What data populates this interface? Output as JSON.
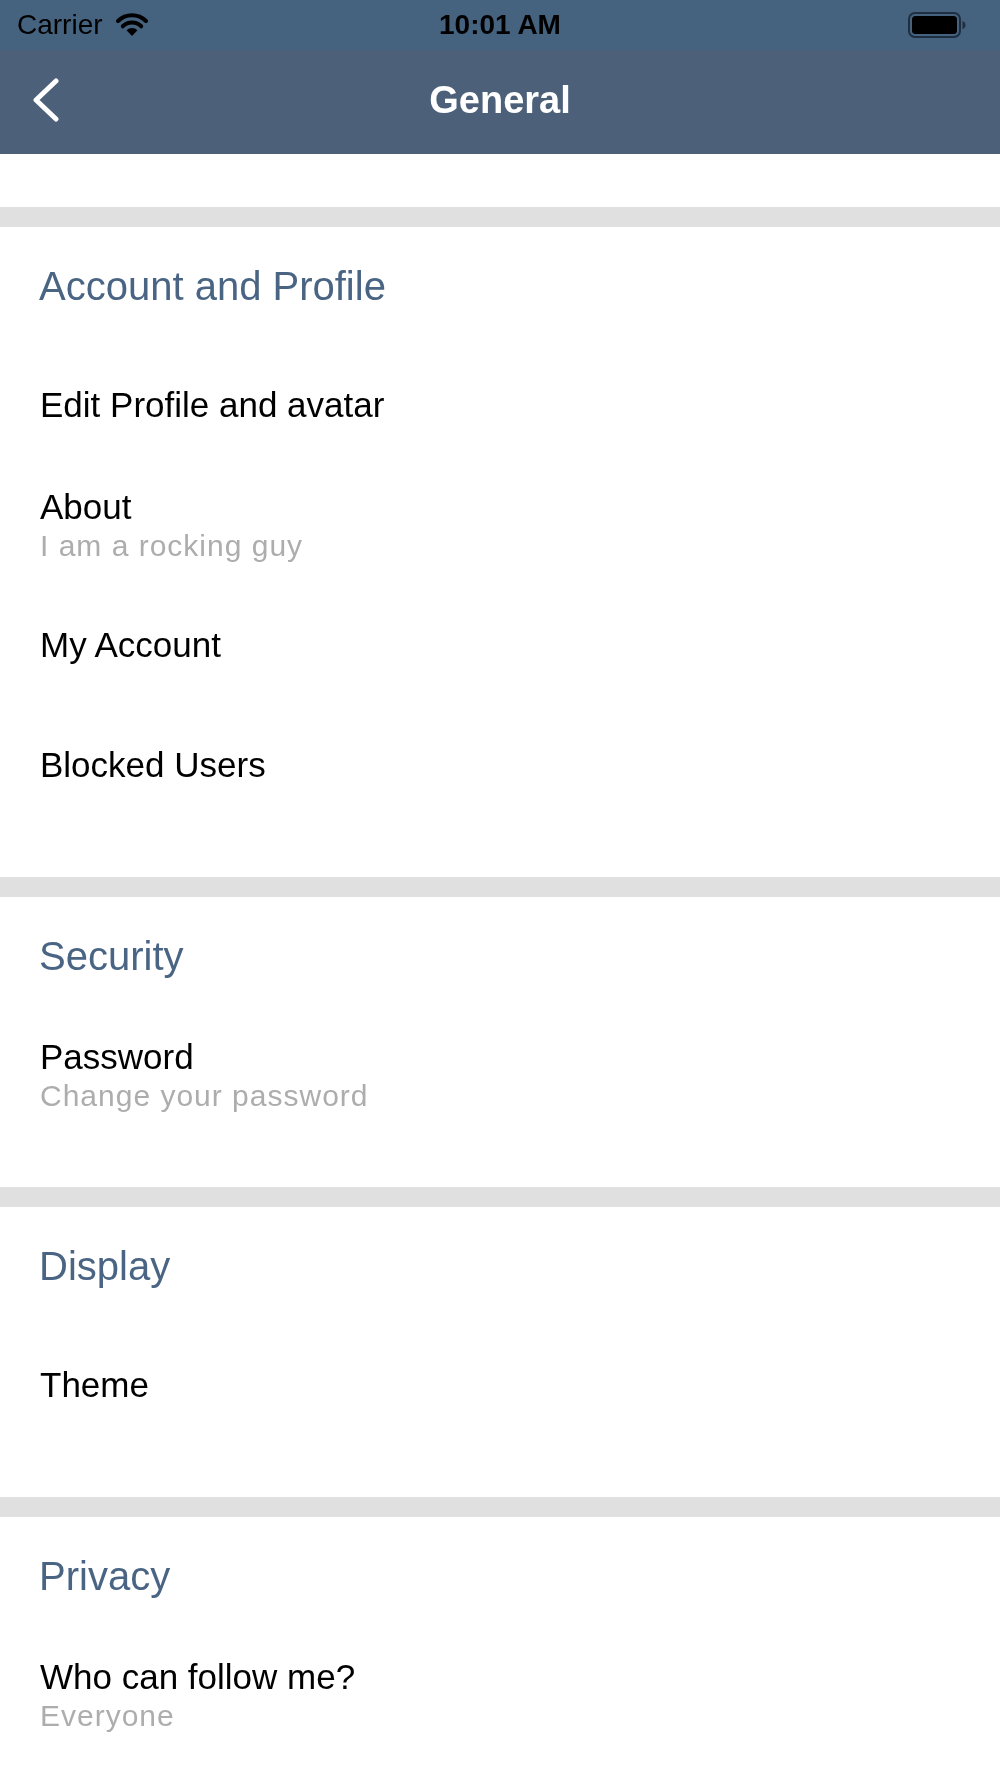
{
  "status_bar": {
    "carrier": "Carrier",
    "time": "10:01 AM"
  },
  "nav_bar": {
    "title": "General"
  },
  "sections": [
    {
      "title": "Account and Profile",
      "items": [
        {
          "label": "Edit Profile and avatar"
        },
        {
          "label": "About",
          "subtitle": "I am a rocking guy"
        },
        {
          "label": "My Account"
        },
        {
          "label": "Blocked Users"
        }
      ]
    },
    {
      "title": "Security",
      "items": [
        {
          "label": "Password",
          "subtitle": "Change your password"
        }
      ]
    },
    {
      "title": "Display",
      "items": [
        {
          "label": "Theme"
        }
      ]
    },
    {
      "title": "Privacy",
      "items": [
        {
          "label": "Who can follow me?",
          "subtitle": "Everyone"
        }
      ]
    }
  ]
}
